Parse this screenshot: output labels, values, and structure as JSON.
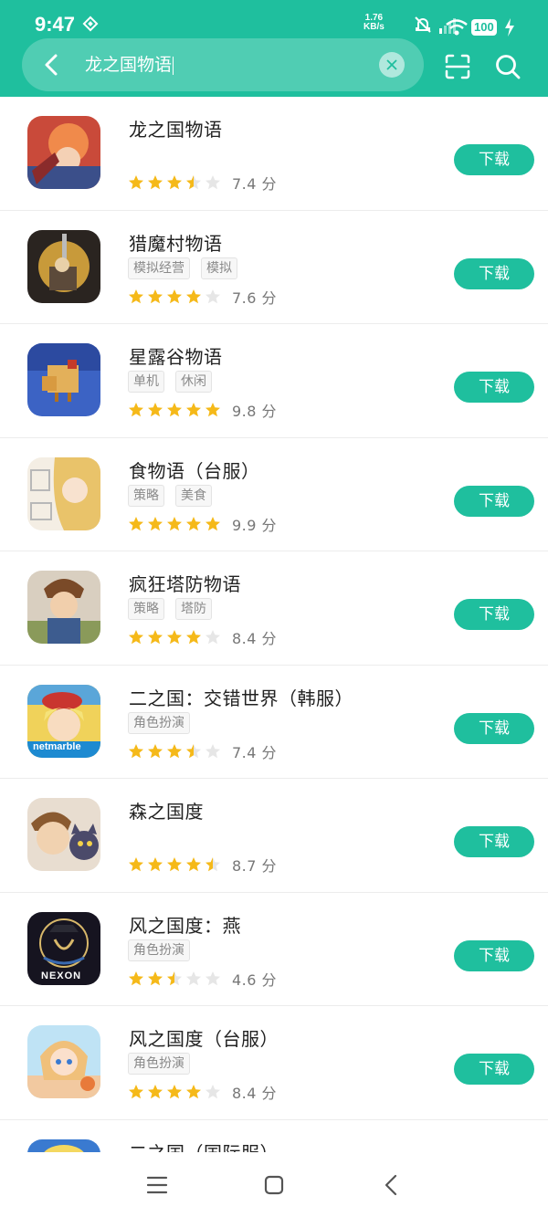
{
  "status_bar": {
    "time": "9:47",
    "net_speed": "1.76",
    "net_unit": "KB/s",
    "battery": "100"
  },
  "search": {
    "query": "龙之国物语"
  },
  "colors": {
    "accent": "#1fbf9e",
    "star": "#f5b919",
    "star_empty": "#e6e6e6"
  },
  "results": [
    {
      "name": "龙之国物语",
      "tags": [],
      "rating": 3.5,
      "score": "7.4 分",
      "button": "下载"
    },
    {
      "name": "猎魔村物语",
      "tags": [
        "模拟经营",
        "模拟"
      ],
      "rating": 4,
      "score": "7.6 分",
      "button": "下载"
    },
    {
      "name": "星露谷物语",
      "tags": [
        "单机",
        "休闲"
      ],
      "rating": 5,
      "score": "9.8 分",
      "button": "下载"
    },
    {
      "name": "食物语（台服）",
      "tags": [
        "策略",
        "美食"
      ],
      "rating": 5,
      "score": "9.9 分",
      "button": "下载"
    },
    {
      "name": "疯狂塔防物语",
      "tags": [
        "策略",
        "塔防"
      ],
      "rating": 4,
      "score": "8.4 分",
      "button": "下载"
    },
    {
      "name": "二之国：交错世界（韩服）",
      "tags": [
        "角色扮演"
      ],
      "rating": 3.5,
      "score": "7.4 分",
      "button": "下载"
    },
    {
      "name": "森之国度",
      "tags": [],
      "rating": 4.5,
      "score": "8.7 分",
      "button": "下载"
    },
    {
      "name": "风之国度：燕",
      "tags": [
        "角色扮演"
      ],
      "rating": 2.5,
      "score": "4.6 分",
      "button": "下载"
    },
    {
      "name": "风之国度（台服）",
      "tags": [
        "角色扮演"
      ],
      "rating": 4,
      "score": "8.4 分",
      "button": "下载"
    },
    {
      "name": "二之国（国际服）",
      "tags": [],
      "rating": 0,
      "score": "",
      "button": ""
    }
  ],
  "icon_names": [
    "game-icon-dragon",
    "game-icon-hunter",
    "game-icon-chicken",
    "game-icon-food",
    "game-icon-tower",
    "game-icon-ninokuni-cross",
    "game-icon-forest",
    "game-icon-wind-yan",
    "game-icon-wind-tw",
    "game-icon-ninokuni-global"
  ]
}
